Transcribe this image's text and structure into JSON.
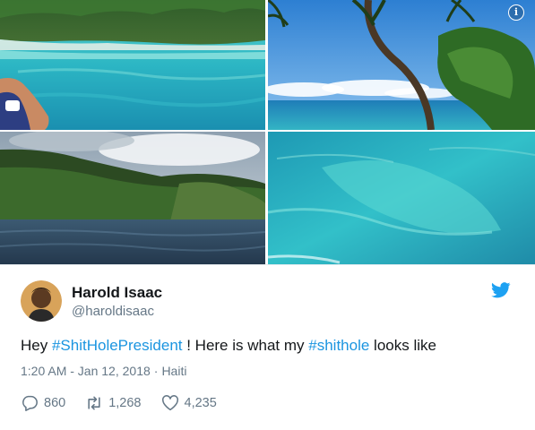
{
  "photos": [
    {
      "name": "turquoise-lagoon-photo"
    },
    {
      "name": "palm-tree-ocean-photo"
    },
    {
      "name": "green-hills-sea-photo"
    },
    {
      "name": "clear-water-closeup-photo"
    }
  ],
  "author": {
    "display_name": "Harold Isaac",
    "handle": "@haroldisaac"
  },
  "tweet": {
    "text_1": "Hey ",
    "hashtag_1": "#ShitHolePresident",
    "text_2": " ! Here is what my ",
    "hashtag_2": "#shithole",
    "text_3": " looks like"
  },
  "meta": {
    "time": "1:20 AM - Jan 12, 2018",
    "separator": "·",
    "location": "Haiti"
  },
  "stats": {
    "replies": "860",
    "retweets": "1,268",
    "likes": "4,235"
  },
  "colors": {
    "brand": "#1da1f2",
    "hashtag": "#1b95e0",
    "muted": "#657786",
    "text": "#14171a"
  },
  "icons": [
    "info-icon",
    "twitter-bird-icon",
    "reply-icon",
    "retweet-icon",
    "like-icon"
  ]
}
